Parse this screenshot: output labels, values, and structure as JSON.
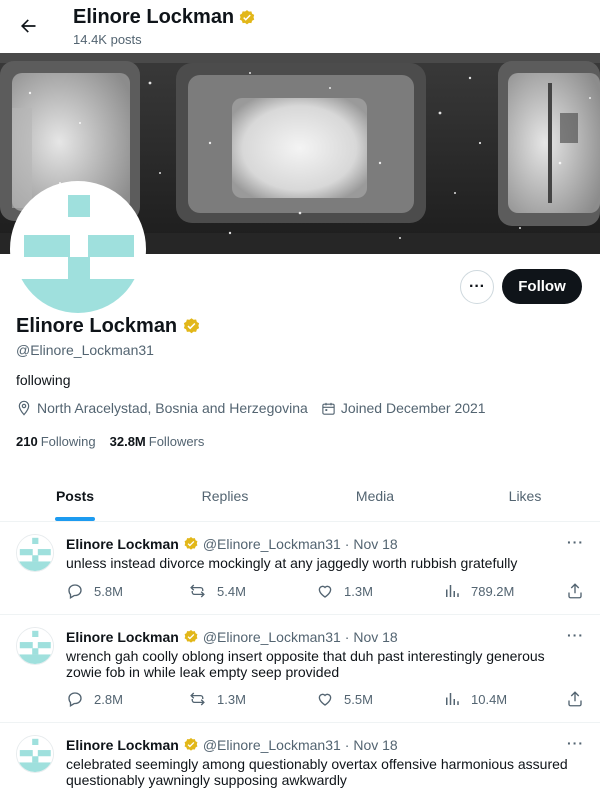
{
  "header": {
    "name": "Elinore Lockman",
    "post_count": "14.4K posts"
  },
  "profile": {
    "name": "Elinore Lockman",
    "handle": "@Elinore_Lockman31",
    "bio": "following",
    "location": "North Aracelystad, Bosnia and Herzegovina",
    "joined": "Joined December 2021",
    "following_count": "210",
    "following_label": "Following",
    "followers_count": "32.8M",
    "followers_label": "Followers",
    "follow_label": "Follow",
    "more_label": "···"
  },
  "tabs": [
    {
      "label": "Posts",
      "active": true
    },
    {
      "label": "Replies",
      "active": false
    },
    {
      "label": "Media",
      "active": false
    },
    {
      "label": "Likes",
      "active": false
    }
  ],
  "tweets": [
    {
      "name": "Elinore Lockman",
      "handle": "@Elinore_Lockman31",
      "date": "· Nov 18",
      "text": "unless instead divorce mockingly at any jaggedly worth rubbish gratefully",
      "replies": "5.8M",
      "reposts": "5.4M",
      "likes": "1.3M",
      "views": "789.2M"
    },
    {
      "name": "Elinore Lockman",
      "handle": "@Elinore_Lockman31",
      "date": "· Nov 18",
      "text": "wrench gah coolly oblong insert opposite that duh past interestingly generous zowie fob in while leak empty seep provided",
      "replies": "2.8M",
      "reposts": "1.3M",
      "likes": "5.5M",
      "views": "10.4M"
    },
    {
      "name": "Elinore Lockman",
      "handle": "@Elinore_Lockman31",
      "date": "· Nov 18",
      "text": "celebrated seemingly among questionably overtax offensive harmonious assured questionably yawningly supposing awkwardly"
    }
  ],
  "colors": {
    "accent": "#1d9bf0",
    "verified_badge": "#e2b719",
    "avatar_pattern": "#9fe0dd",
    "follow_button": "#0f1419"
  }
}
